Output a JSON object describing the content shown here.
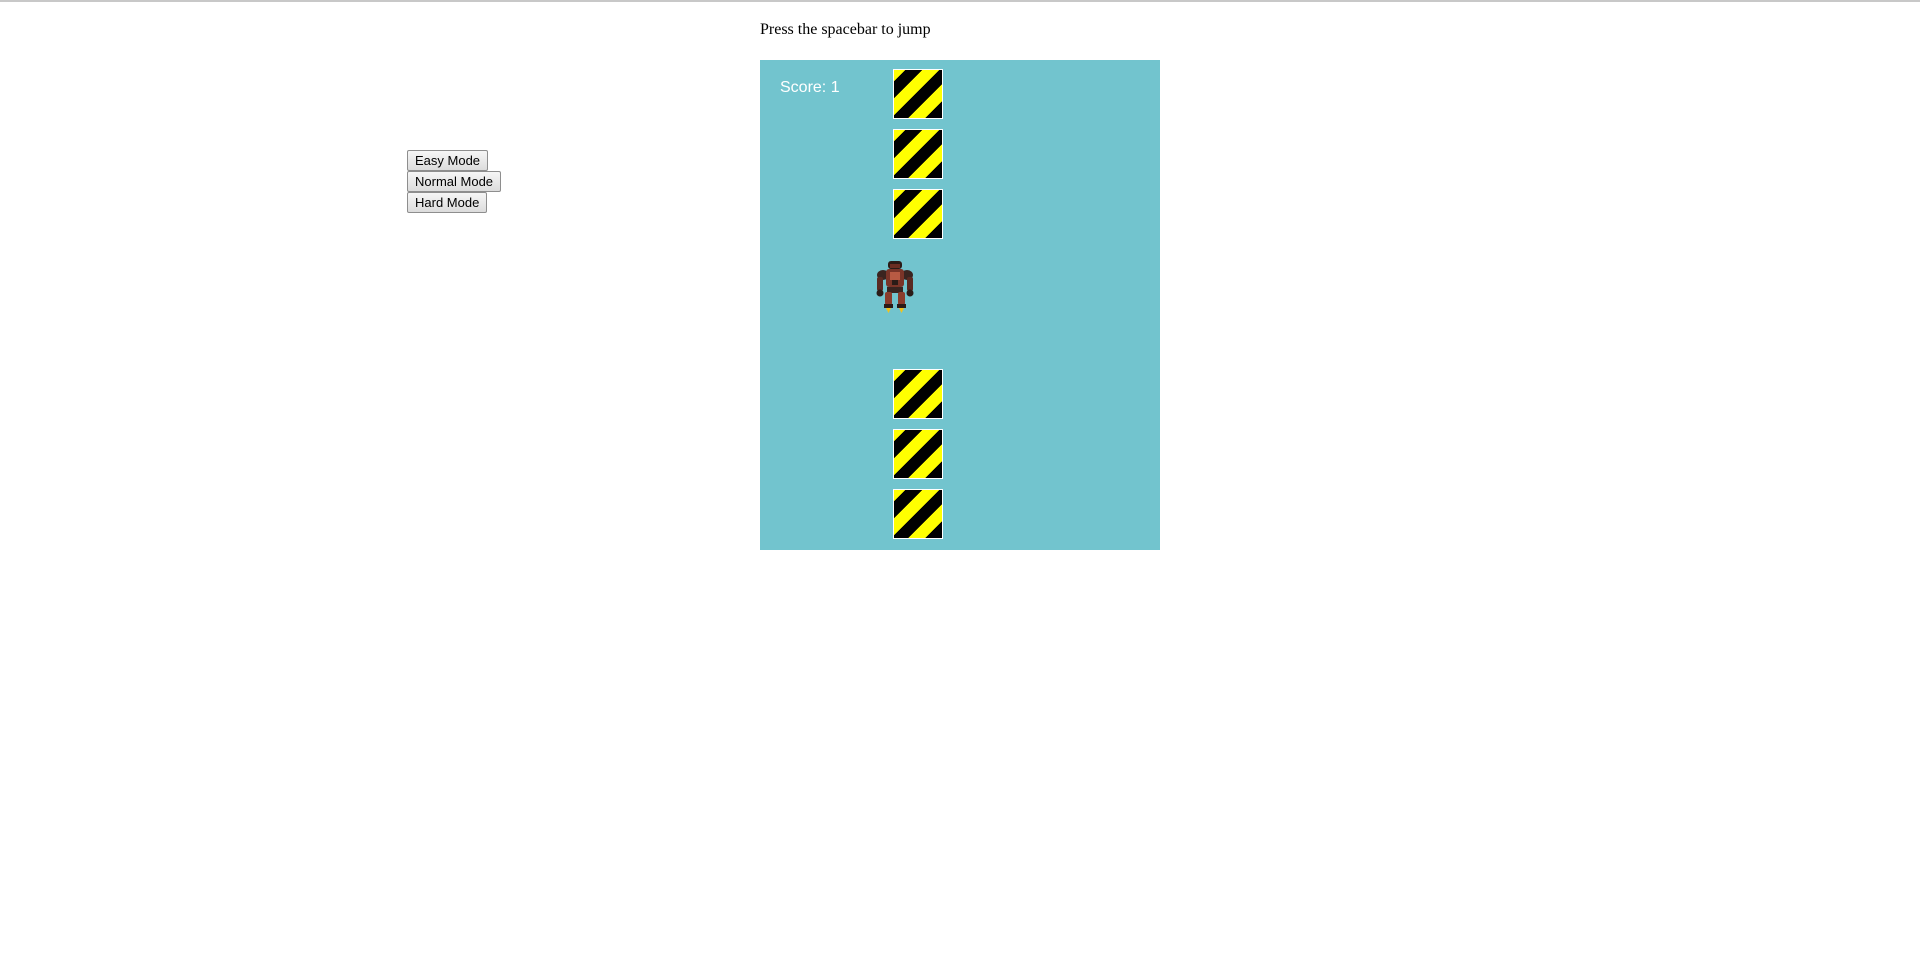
{
  "instructions": "Press the spacebar to jump",
  "modes": {
    "easy": "Easy Mode",
    "normal": "Normal Mode",
    "hard": "Hard Mode"
  },
  "game": {
    "score_label": "Score:",
    "score_value": "1",
    "background_color": "#72c4ce",
    "block_colors": [
      "#000000",
      "#ffff00"
    ],
    "player_icon": "robot-icon"
  }
}
